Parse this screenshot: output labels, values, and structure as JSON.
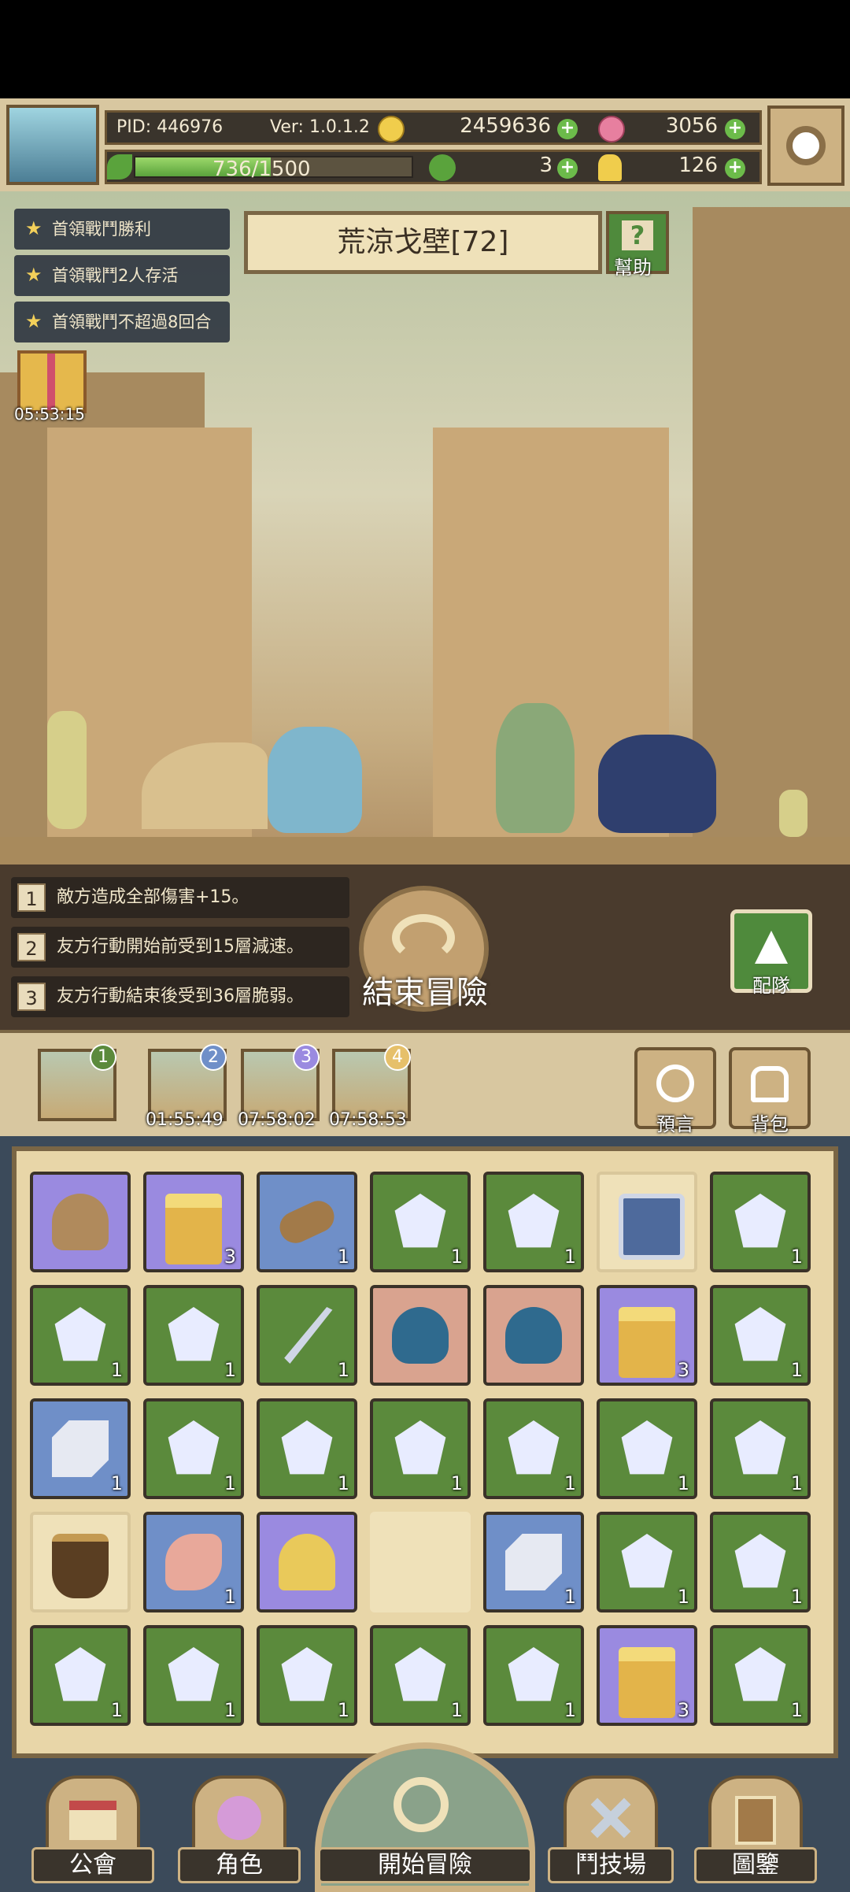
{
  "player": {
    "pid": "PID: 446976",
    "version": "Ver: 1.0.1.2",
    "gold": "2459636",
    "gems": "3056",
    "xp": "736/1500",
    "xp_fraction": 0.49,
    "clover": "3",
    "key": "126"
  },
  "quests": [
    "首領戰鬥勝利",
    "首領戰鬥2人存活",
    "首領戰鬥不超過8回合"
  ],
  "stage": {
    "title": "荒涼戈壁[72]",
    "help_label": "幫助"
  },
  "gift_timer": "05:53:15",
  "effects": [
    {
      "num": "1",
      "text": "敵方造成全部傷害+15。"
    },
    {
      "num": "2",
      "text": "友方行動開始前受到15層減速。"
    },
    {
      "num": "3",
      "text": "友方行動結束後受到36層脆弱。"
    }
  ],
  "end_label": "結束冒險",
  "team_label": "配隊",
  "slots": [
    {
      "num": "1",
      "timer": ""
    },
    {
      "num": "2",
      "timer": "01:55:49"
    },
    {
      "num": "3",
      "timer": "07:58:02"
    },
    {
      "num": "4",
      "timer": "07:58:53"
    }
  ],
  "side": {
    "prophecy": "預言",
    "bag": "背包"
  },
  "inventory": [
    [
      "purple:rock:",
      "purple:chest:3",
      "blue:log:1",
      "green:crystal:1",
      "green:crystal:1",
      "tan:box:",
      "green:crystal:1"
    ],
    [
      "green:crystal:1",
      "green:crystal:1",
      "green:knife:1",
      "pink:slime:",
      "pink:slime:",
      "purple:chest:3",
      "green:crystal:1"
    ],
    [
      "blue:cube:1",
      "green:crystal:1",
      "green:crystal:1",
      "green:crystal:1",
      "green:crystal:1",
      "green:crystal:1",
      "green:crystal:1"
    ],
    [
      "tan:pot:",
      "blue:meat:1",
      "purple:gold:",
      "empty::",
      "blue:cube:1",
      "green:crystal:1",
      "green:crystal:1"
    ],
    [
      "green:crystal:1",
      "green:crystal:1",
      "green:crystal:1",
      "green:crystal:1",
      "green:crystal:1",
      "purple:chest:3",
      "green:crystal:1"
    ]
  ],
  "nav": [
    "公會",
    "角色",
    "開始冒險",
    "鬥技場",
    "圖鑒"
  ],
  "colors": {
    "accent_green": "#5b8a3c",
    "panel_tan": "#d8c7a0",
    "frame_brown": "#7a6645"
  }
}
